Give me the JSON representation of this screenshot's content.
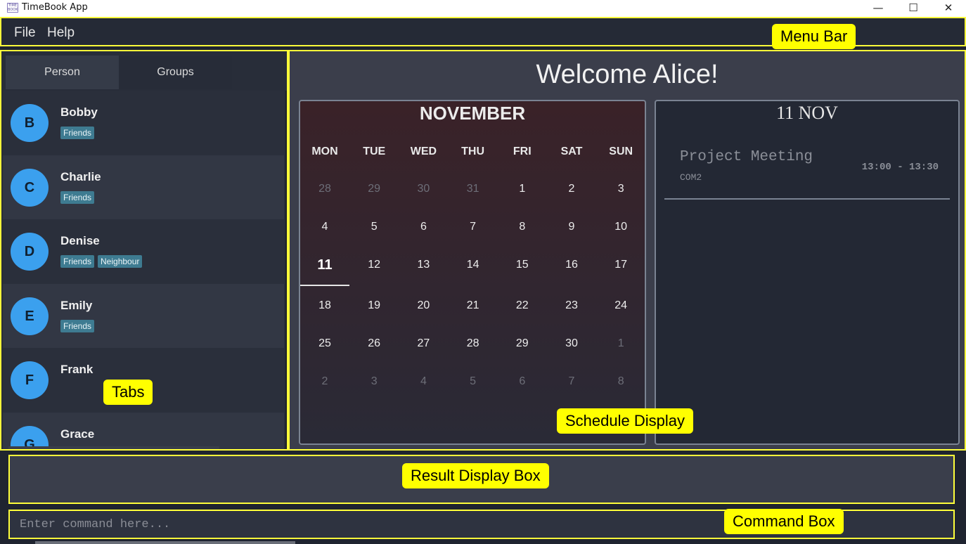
{
  "window": {
    "title": "TimeBook App",
    "icon_text": "TIME BOOK",
    "minimize": "—",
    "maximize": "☐",
    "close": "✕"
  },
  "menu": {
    "file": "File",
    "help": "Help"
  },
  "tabs": {
    "person": "Person",
    "groups": "Groups"
  },
  "persons": [
    {
      "initial": "B",
      "name": "Bobby",
      "tags": [
        "Friends"
      ]
    },
    {
      "initial": "C",
      "name": "Charlie",
      "tags": [
        "Friends"
      ]
    },
    {
      "initial": "D",
      "name": "Denise",
      "tags": [
        "Friends",
        "Neighbour"
      ]
    },
    {
      "initial": "E",
      "name": "Emily",
      "tags": [
        "Friends"
      ]
    },
    {
      "initial": "F",
      "name": "Frank",
      "tags": []
    },
    {
      "initial": "G",
      "name": "Grace",
      "tags": []
    }
  ],
  "welcome": "Welcome Alice!",
  "calendar": {
    "month": "NOVEMBER",
    "weekdays": [
      "MON",
      "TUE",
      "WED",
      "THU",
      "FRI",
      "SAT",
      "SUN"
    ],
    "today": "11",
    "weeks": [
      [
        "28",
        "29",
        "30",
        "31",
        "1",
        "2",
        "3"
      ],
      [
        "4",
        "5",
        "6",
        "7",
        "8",
        "9",
        "10"
      ],
      [
        "11",
        "12",
        "13",
        "14",
        "15",
        "16",
        "17"
      ],
      [
        "18",
        "19",
        "20",
        "21",
        "22",
        "23",
        "24"
      ],
      [
        "25",
        "26",
        "27",
        "28",
        "29",
        "30",
        "1"
      ],
      [
        "2",
        "3",
        "4",
        "5",
        "6",
        "7",
        "8"
      ]
    ],
    "muted": [
      [
        true,
        true,
        true,
        true,
        false,
        false,
        false
      ],
      [
        false,
        false,
        false,
        false,
        false,
        false,
        false
      ],
      [
        false,
        false,
        false,
        false,
        false,
        false,
        false
      ],
      [
        false,
        false,
        false,
        false,
        false,
        false,
        false
      ],
      [
        false,
        false,
        false,
        false,
        false,
        false,
        true
      ],
      [
        true,
        true,
        true,
        true,
        true,
        true,
        true
      ]
    ]
  },
  "schedule": {
    "date": "11 NOV",
    "events": [
      {
        "title": "Project Meeting",
        "location": "COM2",
        "time": "13:00 - 13:30"
      }
    ]
  },
  "result": {
    "text": ""
  },
  "command": {
    "placeholder": "Enter command here..."
  },
  "callouts": {
    "menu_bar": "Menu Bar",
    "tabs": "Tabs",
    "schedule_display": "Schedule Display",
    "result_display_box": "Result Display Box",
    "command_box": "Command Box"
  }
}
